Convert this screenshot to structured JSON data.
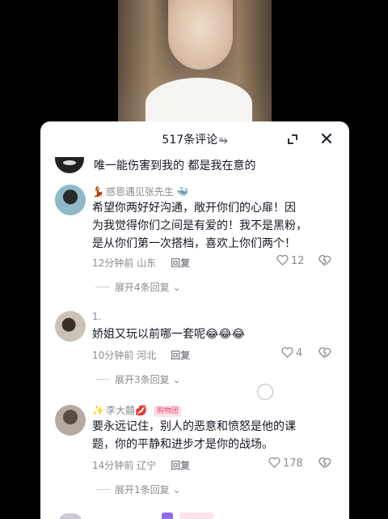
{
  "header": {
    "title": "517条评论",
    "title_icon": "⥱",
    "expand_icon": "expand-icon",
    "close_icon": "close-icon"
  },
  "previous_comment": {
    "text": "唯一能伤害到我的 都是我在意的"
  },
  "comments": [
    {
      "author_prefix": "💃",
      "author": "感恩遇见张先生",
      "author_suffix": "🐳",
      "badge": "",
      "lines": [
        "希望你两好好沟通，敞开你们的心扉！因",
        "为我觉得你们之间是有爱的！我不是黑粉，",
        "是从你们第一次搭档，喜欢上你们两个！"
      ],
      "time_location": "12分钟前 山东",
      "reply_label": "回复",
      "likes": "12",
      "expand_label": "展开4条回复"
    },
    {
      "author_prefix": "",
      "author": "1.",
      "author_suffix": "",
      "badge": "",
      "lines": [
        "娇姐又玩以前哪一套呢😂😂😂"
      ],
      "time_location": "10分钟前 河北",
      "reply_label": "回复",
      "likes": "4",
      "expand_label": "展开3条回复"
    },
    {
      "author_prefix": "✨",
      "author": "李大囍",
      "author_suffix": "💋",
      "badge": "购物团",
      "lines": [
        "要永远记住，别人的恶意和愤怒是他的课",
        "题，你的平静和进步才是你的战场。"
      ],
      "time_location": "14分钟前 辽宁",
      "reply_label": "回复",
      "likes": "178",
      "expand_label": "展开1条回复"
    }
  ],
  "colors": {
    "text_primary": "#161823",
    "text_secondary": "#8a8b91",
    "badge_bg": "#fde4ea",
    "badge_fg": "#e0406a"
  }
}
